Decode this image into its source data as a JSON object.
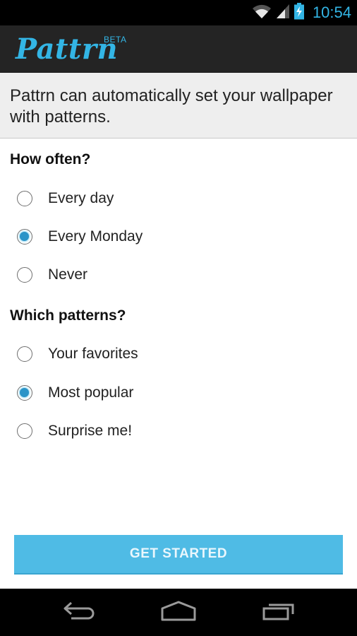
{
  "status_bar": {
    "time": "10:54",
    "icons": [
      "wifi-icon",
      "signal-icon",
      "battery-charging-icon"
    ]
  },
  "action_bar": {
    "app_name": "Pattrn",
    "badge": "BETA",
    "brand_color": "#33b5e5"
  },
  "intro": {
    "text": "Pattrn can automatically set your wallpaper with patterns."
  },
  "frequency": {
    "heading": "How often?",
    "options": [
      {
        "label": "Every day",
        "selected": false
      },
      {
        "label": "Every Monday",
        "selected": true
      },
      {
        "label": "Never",
        "selected": false
      }
    ]
  },
  "patterns": {
    "heading": "Which patterns?",
    "options": [
      {
        "label": "Your favorites",
        "selected": false
      },
      {
        "label": "Most popular",
        "selected": true
      },
      {
        "label": "Surprise me!",
        "selected": false
      }
    ]
  },
  "primary_button": {
    "label": "GET STARTED",
    "color": "#4fbbe5"
  },
  "nav_bar": {
    "buttons": [
      "back-icon",
      "home-icon",
      "recent-apps-icon"
    ]
  }
}
